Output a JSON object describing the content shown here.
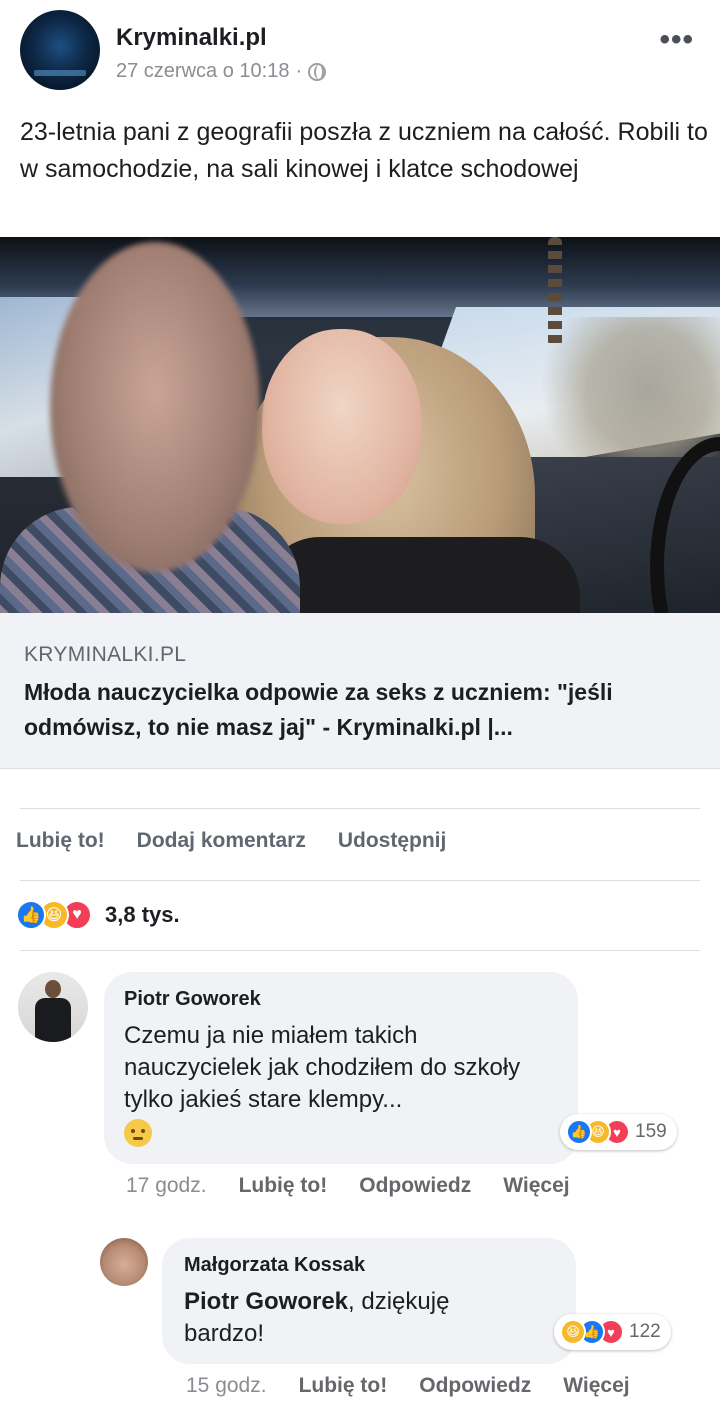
{
  "post": {
    "page_name": "Kryminalki.pl",
    "timestamp": "27 czerwca o 10:18",
    "meta_separator": "·",
    "text": "23-letnia pani z geografii poszła z uczniem na całość. Robili to w samochodzie, na sali kinowej i klatce schodowej",
    "more_icon": "more-icon"
  },
  "link": {
    "domain": "KRYMINALKI.PL",
    "title": "Młoda nauczycielka odpowie za seks z uczniem: \"jeśli odmówisz, to nie masz jaj\" - Kryminalki.pl |..."
  },
  "actions": {
    "like": "Lubię to!",
    "comment": "Dodaj komentarz",
    "share": "Udostępnij"
  },
  "reactions": {
    "icons": [
      "like-icon",
      "haha-icon",
      "love-icon"
    ],
    "count": "3,8 tys."
  },
  "comments": [
    {
      "author": "Piotr Goworek",
      "text": "Czemu ja nie miałem takich nauczycielek jak chodziłem do szkoły tylko jakieś stare klempy...",
      "emoji": "pensive-face-emoji",
      "reaction_icons": [
        "like-icon",
        "haha-icon",
        "love-icon"
      ],
      "reaction_count": "159",
      "time": "17 godz.",
      "like": "Lubię to!",
      "reply": "Odpowiedz",
      "more": "Więcej"
    },
    {
      "author": "Małgorzata Kossak",
      "mention": "Piotr Goworek",
      "text": ", dziękuję bardzo!",
      "reaction_icons": [
        "haha-icon",
        "like-icon",
        "love-icon"
      ],
      "reaction_count": "122",
      "time": "15 godz.",
      "like": "Lubię to!",
      "reply": "Odpowiedz",
      "more": "Więcej"
    }
  ],
  "colors": {
    "accent": "#1877f2",
    "text": "#1c1e21",
    "muted": "#65676b",
    "bubble": "#f0f2f5"
  }
}
